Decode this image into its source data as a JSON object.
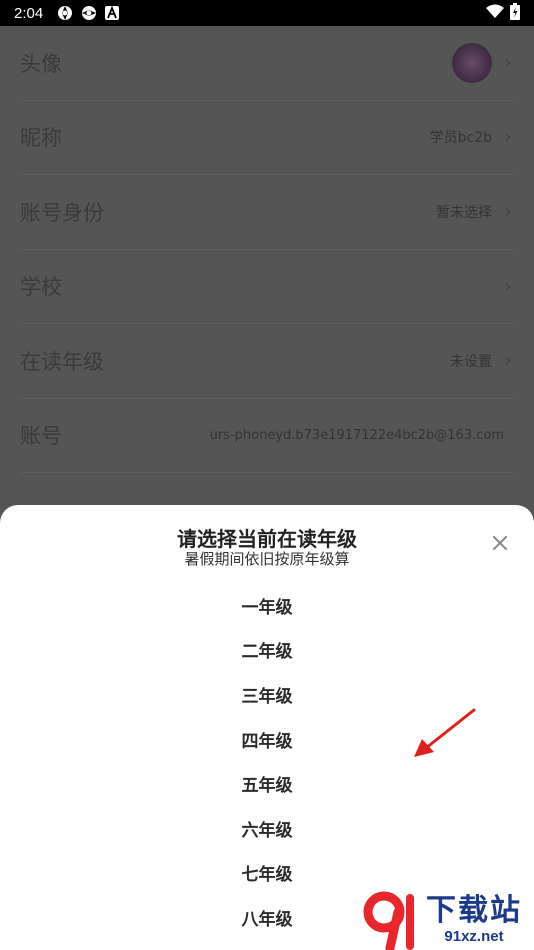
{
  "status_bar": {
    "time": "2:04",
    "icons": [
      "aperture-icon",
      "aperture-icon",
      "a-letter-icon"
    ],
    "right_icons": [
      "wifi-icon",
      "battery-icon"
    ]
  },
  "settings": {
    "rows": [
      {
        "label": "头像",
        "value": "",
        "type": "avatar"
      },
      {
        "label": "昵称",
        "value": "学员bc2b"
      },
      {
        "label": "账号身份",
        "value": "暂未选择"
      },
      {
        "label": "学校",
        "value": ""
      },
      {
        "label": "在读年级",
        "value": "未设置"
      },
      {
        "label": "账号",
        "value": "urs-phoneyd.b73e1917122e4bc2b@163.com"
      }
    ]
  },
  "sheet": {
    "title": "请选择当前在读年级",
    "subtitle": "暑假期间依旧按原年级算",
    "close_icon": "close-icon",
    "grades": [
      "一年级",
      "二年级",
      "三年级",
      "四年级",
      "五年级",
      "六年级",
      "七年级",
      "八年级"
    ]
  },
  "watermark": {
    "big_text": "下载站",
    "small_text": "91xz.net"
  },
  "colors": {
    "overlay": "#555555",
    "sheet_bg": "#ffffff",
    "arrow": "#e0201c",
    "watermark_blue": "#1c3a8c",
    "watermark_red": "#e8262c"
  }
}
